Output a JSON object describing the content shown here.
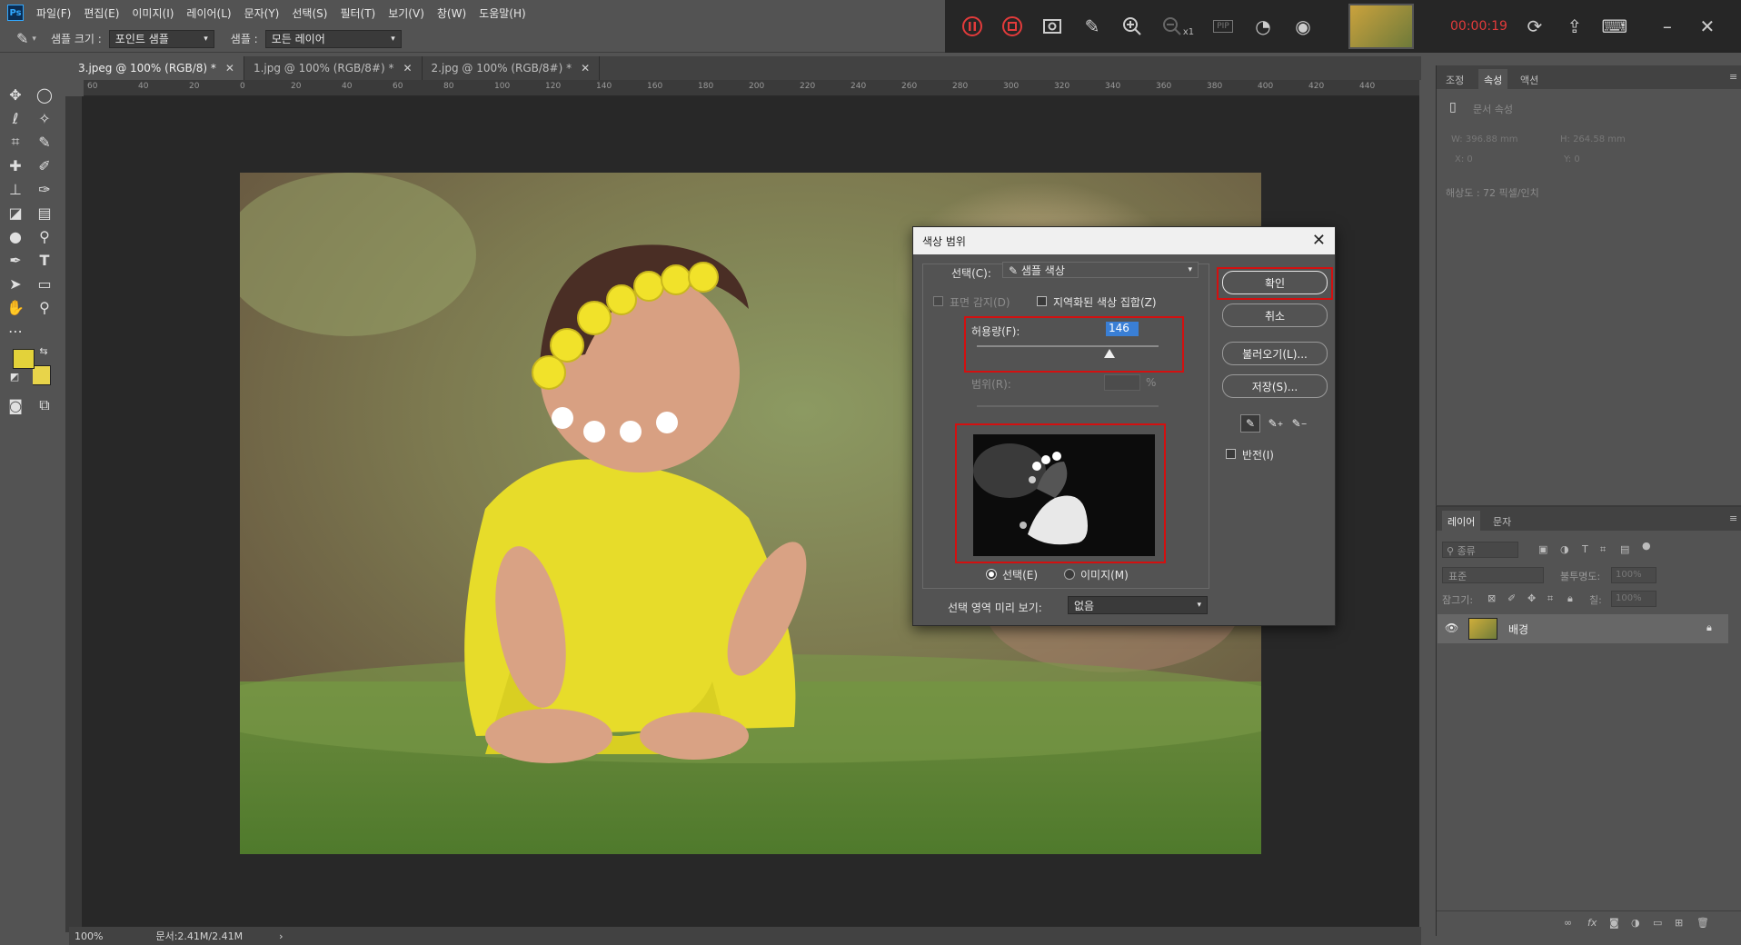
{
  "app": {
    "logo": "Ps"
  },
  "menu": [
    "파일(F)",
    "편집(E)",
    "이미지(I)",
    "레이어(L)",
    "문자(Y)",
    "선택(S)",
    "필터(T)",
    "보기(V)",
    "창(W)",
    "도움말(H)"
  ],
  "options": {
    "sample_size_label": "샘플 크기 :",
    "sample_size_value": "포인트 샘플",
    "sample_label": "샘플 :",
    "sample_value": "모든 레이어"
  },
  "recorder": {
    "zoom_label": "x1",
    "pip_label": "PIP",
    "timer": "00:00:19"
  },
  "tabs": [
    {
      "label": "3.jpeg @ 100% (RGB/8) *"
    },
    {
      "label": "1.jpg @ 100% (RGB/8#) *"
    },
    {
      "label": "2.jpg @ 100% (RGB/8#) *"
    }
  ],
  "ruler": [
    "60",
    "40",
    "20",
    "0",
    "20",
    "40",
    "60",
    "80",
    "100",
    "120",
    "140",
    "160",
    "180",
    "200",
    "220",
    "240",
    "260",
    "280",
    "300",
    "320",
    "340",
    "360",
    "380",
    "400",
    "420",
    "440"
  ],
  "dialog": {
    "title": "색상 범위",
    "select_label": "선택(C):",
    "select_value": "샘플 색상",
    "detect_faces": "표면 감지(D)",
    "localized": "지역화된 색상 집합(Z)",
    "fuzziness_label": "허용량(F):",
    "fuzziness_value": "146",
    "fuzziness_fraction": 0.73,
    "range_label": "범위(R):",
    "range_unit": "%",
    "radio_selection": "선택(E)",
    "radio_image": "이미지(M)",
    "preview_label": "선택 영역 미리 보기:",
    "preview_value": "없음",
    "ok": "확인",
    "cancel": "취소",
    "load": "불러오기(L)...",
    "save": "저장(S)...",
    "invert": "반전(I)"
  },
  "properties": {
    "tabs": [
      "조정",
      "속성",
      "액션"
    ],
    "doc_title": "문서 속성",
    "w": "W:  396.88 mm",
    "h": "H:  264.58 mm",
    "x": "X:  0",
    "y": "Y:  0",
    "resolution": "해상도 : 72 픽셀/인치"
  },
  "layers": {
    "tabs": [
      "레이어",
      "문자"
    ],
    "filter_label": "종류",
    "blend_mode": "표준",
    "opacity_label": "불투명도:",
    "opacity_value": "100%",
    "lock_label": "잠그기:",
    "fill_label": "칠:",
    "fill_value": "100%",
    "layer_name": "배경"
  },
  "status": {
    "zoom": "100%",
    "doc": "문서:2.41M/2.41M"
  },
  "colors": {
    "foreground": "#e3d23a",
    "background": "#e8d44a",
    "accent_red": "#d31010",
    "selection_blue": "#3a7fd5"
  }
}
